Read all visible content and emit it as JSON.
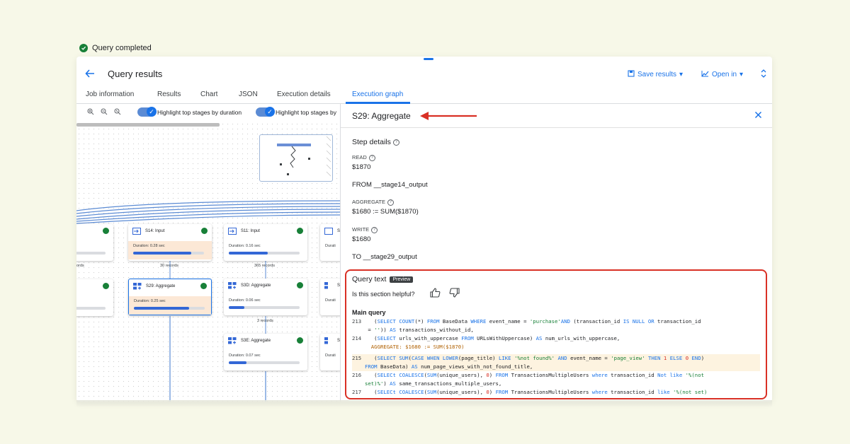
{
  "status": {
    "text": "Query completed"
  },
  "header": {
    "title": "Query results",
    "save_label": "Save results",
    "open_label": "Open in"
  },
  "tabs": [
    {
      "label": "Job information"
    },
    {
      "label": "Results"
    },
    {
      "label": "Chart"
    },
    {
      "label": "JSON"
    },
    {
      "label": "Execution details"
    },
    {
      "label": "Execution graph"
    }
  ],
  "toolbar": {
    "highlight_label_1": "Highlight top stages by duration",
    "highlight_label_2": "Highlight top stages by"
  },
  "graph": {
    "nodes": [
      {
        "name": "S14: Input",
        "duration": "Duration: 0.28 sec",
        "progress": 0.82
      },
      {
        "name": "S11: Input",
        "duration": "Duration: 0.16 sec",
        "progress": 0.55
      },
      {
        "name": "S29: Aggregate",
        "duration": "Duration: 0.25 sec",
        "progress": 0.78
      },
      {
        "name": "S3D: Aggregate",
        "duration": "Duration: 0.06 sec",
        "progress": 0.22
      },
      {
        "name": "S3E: Aggregate",
        "duration": "Duration: 0.07 sec",
        "progress": 0.25
      },
      {
        "name": "S",
        "duration": "Durati",
        "progress": 0.3
      },
      {
        "name": "S",
        "duration": "Durati",
        "progress": 0.3
      },
      {
        "name": "S",
        "duration": "Durati",
        "progress": 0.3
      }
    ],
    "edges": [
      "30 records",
      "365 records",
      "3 records",
      "ords"
    ]
  },
  "panel": {
    "title": "S29: Aggregate",
    "step_details": "Step details",
    "read_label": "READ",
    "read_value": "$1870",
    "from_text": "FROM __stage14_output",
    "aggregate_label": "AGGREGATE",
    "aggregate_value": "$1680 := SUM($1870)",
    "write_label": "WRITE",
    "write_value": "$1680",
    "to_text": "TO __stage29_output",
    "query_text_label": "Query text",
    "preview_badge": "Preview",
    "helpful_text": "Is this section helpful?",
    "main_query_label": "Main query",
    "code": {
      "l213": "213",
      "l214": "214",
      "l215": "215",
      "l216": "216",
      "l217": "217"
    }
  }
}
